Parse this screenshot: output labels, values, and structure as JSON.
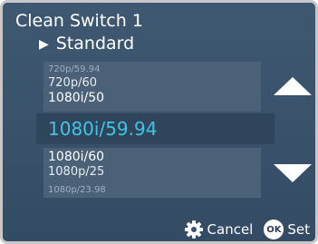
{
  "header": {
    "title": "Clean Switch 1",
    "subtitle_arrow": "▶",
    "subtitle": "Standard"
  },
  "format_list": {
    "items_above": [
      "720p/59.94",
      "720p/60",
      "1080i/50"
    ],
    "selected": "1080i/59.94",
    "items_below": [
      "1080i/60",
      "1080p/25",
      "1080p/23.98"
    ]
  },
  "footer": {
    "cancel_label": "Cancel",
    "ok_badge": "OK",
    "set_label": "Set"
  },
  "colors": {
    "background": "#3b536c",
    "selected_text": "#41c4e6",
    "text": "#ffffff"
  },
  "icons": {
    "scroll_up": "triangle-up-icon",
    "scroll_down": "triangle-down-icon",
    "cancel": "gear-icon",
    "set": "ok-icon"
  }
}
